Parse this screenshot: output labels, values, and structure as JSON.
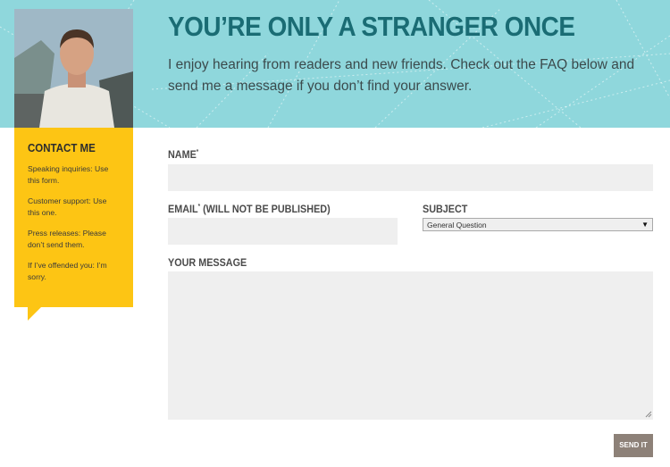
{
  "hero": {
    "title": "YOU’RE ONLY A STRANGER ONCE",
    "intro": "I enjoy hearing from readers and new friends. Check out the FAQ below and send me a message if you don’t find your answer.",
    "background_color": "#8fd7dc",
    "title_color": "#1a6c74"
  },
  "sidebar": {
    "title": "CONTACT ME",
    "background_color": "#fdc514",
    "items": [
      "Speaking inquiries: Use this form.",
      "Customer support: Use this one.",
      "Press releases: Please don’t send them.",
      "If I’ve offended you: I’m sorry."
    ]
  },
  "form": {
    "name_label": "NAME",
    "name_required": "*",
    "email_label": "EMAIL",
    "email_required": "*",
    "email_note": " (WILL NOT BE PUBLISHED)",
    "subject_label": "SUBJECT",
    "subject_value": "General Question",
    "message_label": "YOUR MESSAGE",
    "send_label": "SEND IT",
    "send_color": "#8d8178"
  }
}
